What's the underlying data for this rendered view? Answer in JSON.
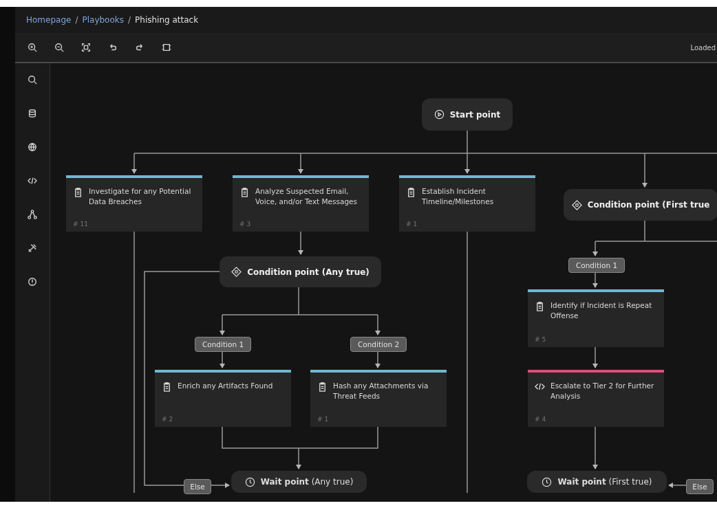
{
  "breadcrumb": {
    "separator": "/",
    "items": [
      {
        "label": "Homepage",
        "kind": "link"
      },
      {
        "label": "Playbooks",
        "kind": "link"
      },
      {
        "label": "Phishing attack",
        "kind": "current"
      }
    ]
  },
  "toolbar": {
    "status": "Loaded"
  },
  "nodes": [
    {
      "kind": "start",
      "label": "Start point"
    },
    {
      "kind": "task",
      "label": "Investigate for any Potential Data Breaches",
      "number": "# 11",
      "color": "#6fb8d2"
    },
    {
      "kind": "task",
      "label": "Analyze Suspected Email, Voice, and/or Text Messages",
      "number": "# 3",
      "color": "#6fb8d2"
    },
    {
      "kind": "task",
      "label": "Establish Incident Timeline/Milestones",
      "number": "# 1",
      "color": "#6fb8d2"
    },
    {
      "kind": "condition",
      "label": "Condition point (First true"
    },
    {
      "kind": "condition",
      "label": "Condition point (Any true)"
    },
    {
      "kind": "task",
      "label": "Identify if Incident is Repeat Offense",
      "number": "# 5",
      "color": "#6fb8d2"
    },
    {
      "kind": "task",
      "label": "Enrich any Artifacts Found",
      "number": "# 2",
      "color": "#6fb8d2"
    },
    {
      "kind": "task",
      "label": "Hash any Attachments via Threat Feeds",
      "number": "# 1",
      "color": "#6fb8d2"
    },
    {
      "kind": "script",
      "label": "Escalate to Tier 2 for Further Analysis",
      "number": "# 4",
      "color": "#d6517a"
    },
    {
      "kind": "wait",
      "label": "**Wait point** (Any true)"
    },
    {
      "kind": "wait",
      "label": "**Wait point** (First true)"
    }
  ],
  "branch_labels": [
    "Condition 1",
    "Condition 1",
    "Condition 2",
    "Else",
    "Else"
  ]
}
